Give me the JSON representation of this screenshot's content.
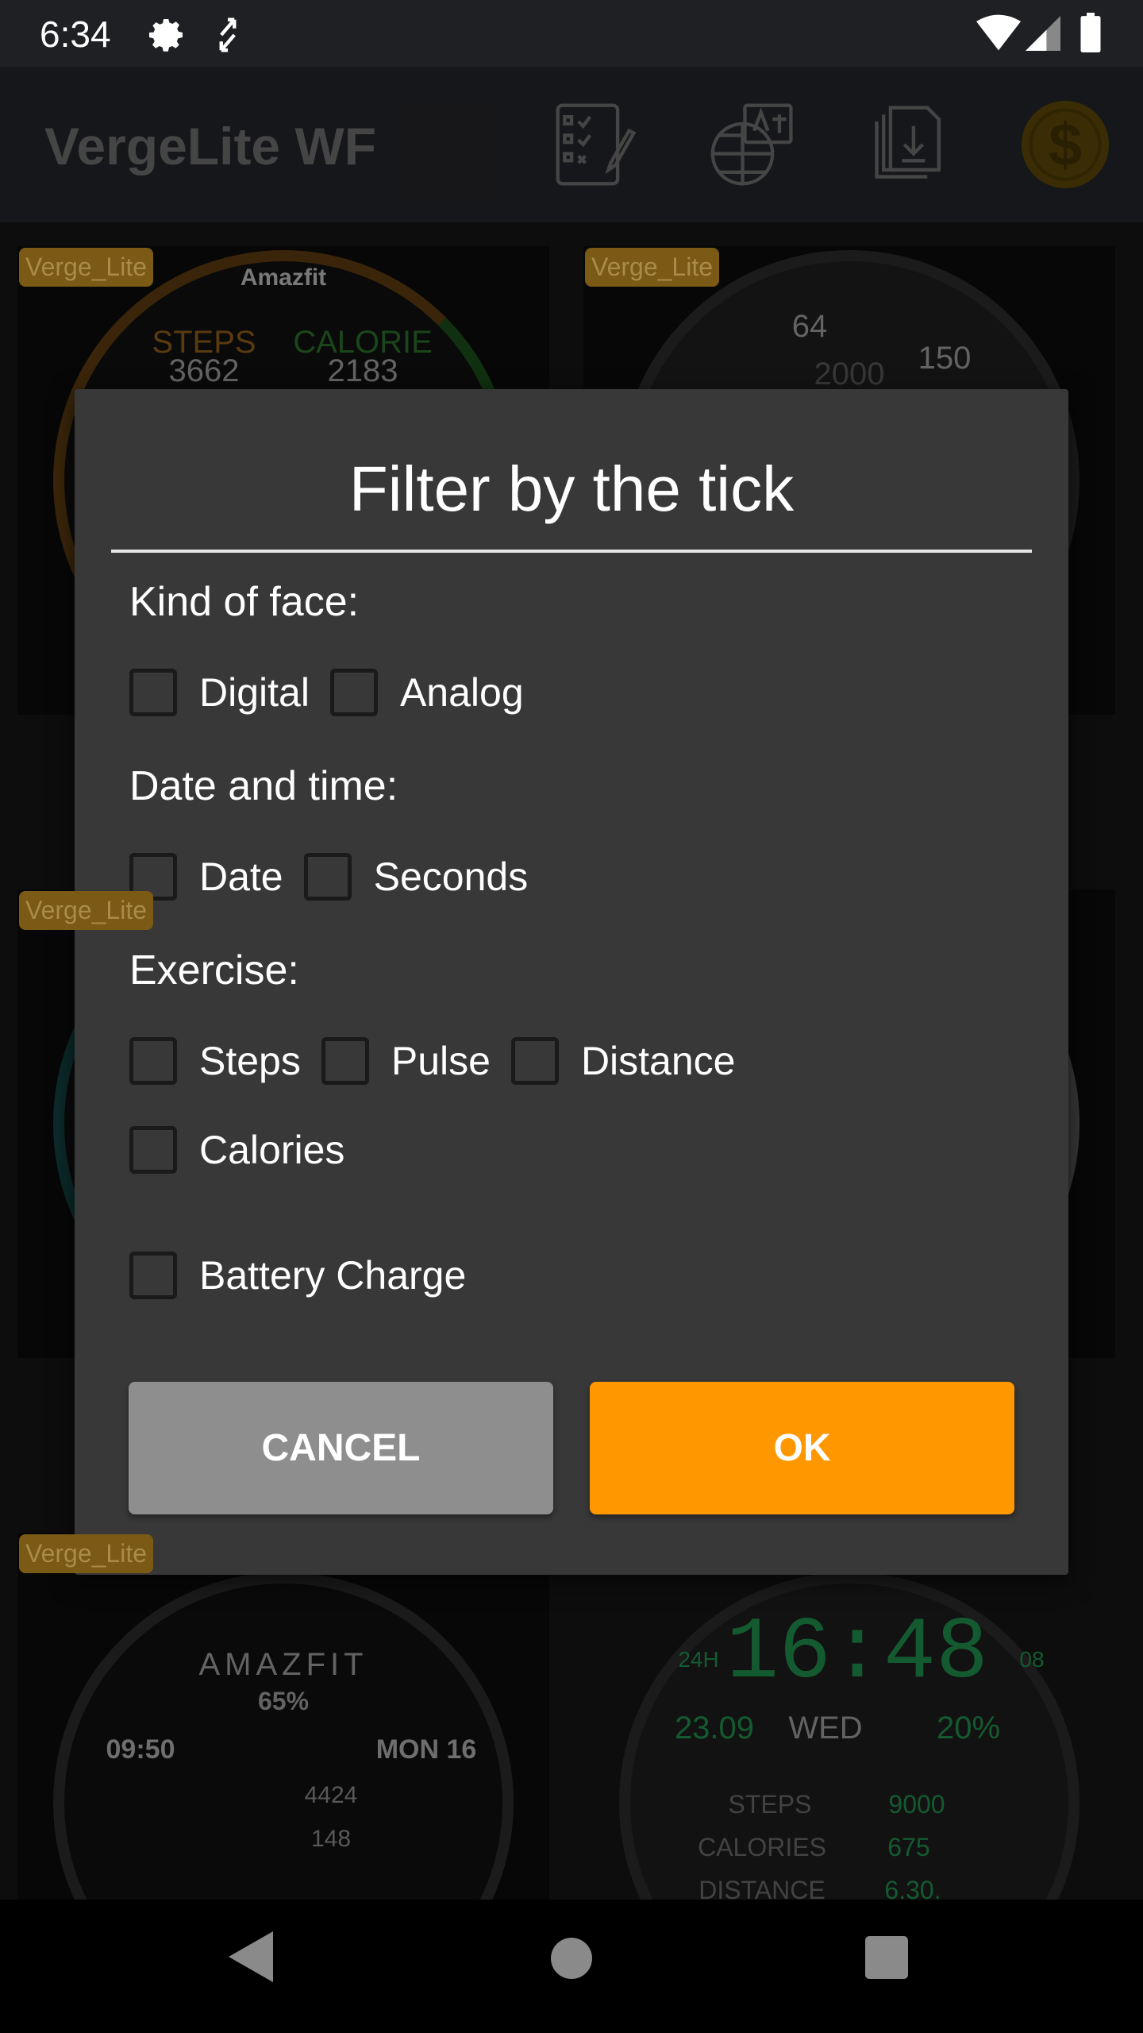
{
  "status_bar": {
    "time": "6:34",
    "icons": [
      "gear-icon",
      "screen-rotate-icon",
      "wifi-icon",
      "signal-icon",
      "battery-icon"
    ]
  },
  "app_bar": {
    "title": "VergeLite WF",
    "actions": [
      "checklist-icon",
      "translate-globe-icon",
      "download-files-icon",
      "dollar-coin-icon"
    ],
    "coin_color": "#5a4608"
  },
  "grid": {
    "badge": "Verge_Lite",
    "cards": [
      {
        "texts": [
          "Amazfit",
          "STEPS",
          "3662",
          "CALORIE",
          "2183"
        ]
      },
      {
        "texts": [
          "64",
          "150",
          "2000"
        ]
      },
      {
        "texts": []
      },
      {
        "texts": []
      },
      {
        "texts": [
          "AMAZFIT",
          "65%",
          "09:50",
          "MON 16",
          "4424",
          "148"
        ]
      },
      {
        "texts": [
          "24H",
          "16:48",
          "08",
          "23.09",
          "WED",
          "20%",
          "STEPS",
          "9000",
          "CALORIES",
          "675",
          "DISTANCE",
          "6.30."
        ]
      }
    ]
  },
  "dialog": {
    "title": "Filter by the tick",
    "sections": [
      {
        "label": "Kind of face:",
        "options": [
          {
            "label": "Digital",
            "checked": false
          },
          {
            "label": "Analog",
            "checked": false
          }
        ]
      },
      {
        "label": "Date and time:",
        "options": [
          {
            "label": "Date",
            "checked": false
          },
          {
            "label": "Seconds",
            "checked": false
          }
        ]
      },
      {
        "label": "Exercise:",
        "options": [
          {
            "label": "Steps",
            "checked": false
          },
          {
            "label": "Pulse",
            "checked": false
          },
          {
            "label": "Distance",
            "checked": false
          },
          {
            "label": "Calories",
            "checked": false
          }
        ]
      },
      {
        "label": "",
        "options": [
          {
            "label": "Battery Charge",
            "checked": false
          }
        ]
      }
    ],
    "cancel_label": "CANCEL",
    "ok_label": "OK",
    "ok_color": "#ff9800",
    "cancel_color": "#8e8e8e"
  },
  "nav_bar": {
    "buttons": [
      "back-icon",
      "home-icon",
      "recents-icon"
    ]
  }
}
